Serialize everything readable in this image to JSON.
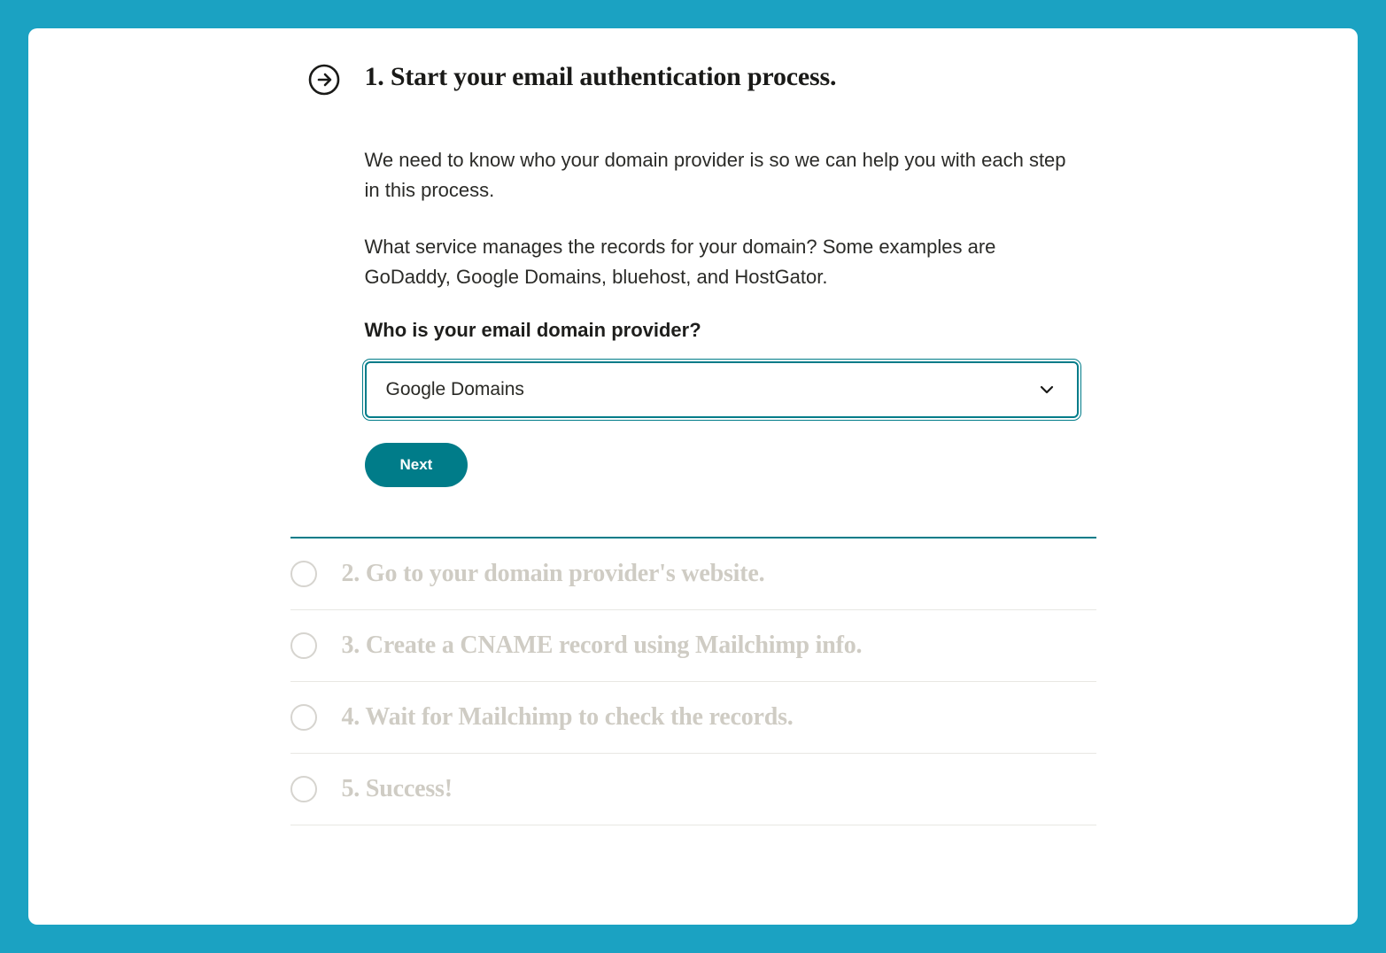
{
  "activeStep": {
    "title": "1. Start your email authentication process.",
    "intro1": "We need to know who your domain provider is so we can help you with each step in this process.",
    "intro2": "What service manages the records for your domain? Some examples are GoDaddy, Google Domains, bluehost, and HostGator.",
    "fieldLabel": "Who is your email domain provider?",
    "selectedProvider": "Google Domains",
    "nextLabel": "Next"
  },
  "futureSteps": [
    {
      "title": "2. Go to your domain provider's website."
    },
    {
      "title": "3. Create a CNAME record using Mailchimp info."
    },
    {
      "title": "4. Wait for Mailchimp to check the records."
    },
    {
      "title": "5. Success!"
    }
  ]
}
